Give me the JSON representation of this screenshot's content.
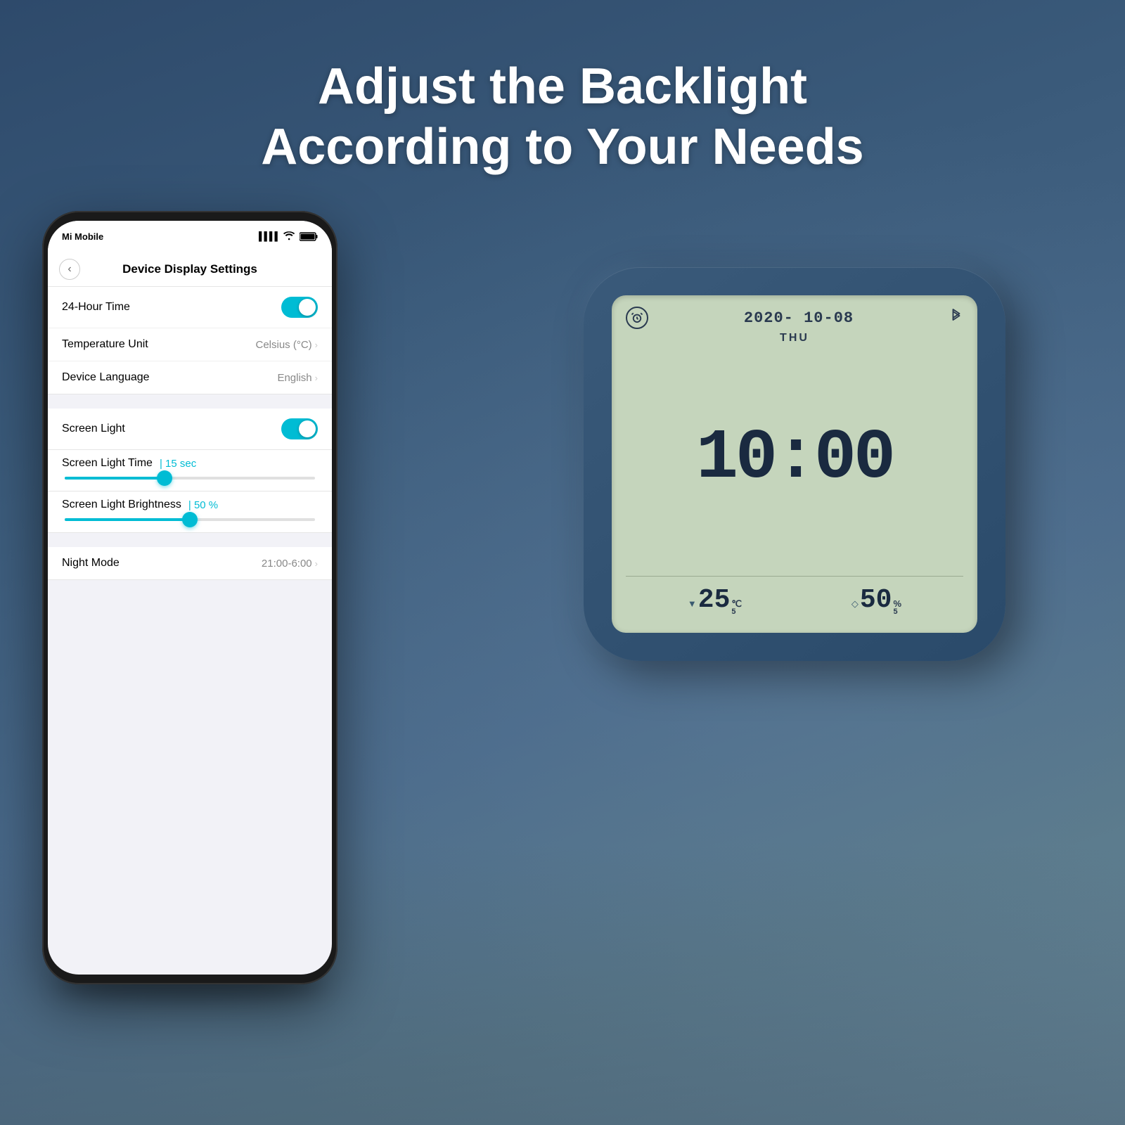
{
  "headline": {
    "line1": "Adjust the Backlight",
    "line2": "According to Your Needs"
  },
  "phone": {
    "status_bar": {
      "carrier": "Mi Mobile",
      "signal_icon": "▌▌▌▌",
      "wifi_icon": "WiFi",
      "battery_icon": "Battery"
    },
    "nav": {
      "back_label": "‹",
      "title": "Device Display Settings"
    },
    "settings": {
      "hour_time_label": "24-Hour Time",
      "hour_time_value": "on",
      "temp_unit_label": "Temperature Unit",
      "temp_unit_value": "Celsius (°C)",
      "device_language_label": "Device Language",
      "device_language_value": "English",
      "screen_light_label": "Screen Light",
      "screen_light_value": "on",
      "screen_light_time_label": "Screen Light Time",
      "screen_light_time_value": "15 sec",
      "screen_light_time_percent": 40,
      "screen_light_brightness_label": "Screen Light Brightness",
      "screen_light_brightness_value": "50 %",
      "screen_light_brightness_percent": 50,
      "night_mode_label": "Night Mode",
      "night_mode_value": "21:00-6:00"
    }
  },
  "clock": {
    "date": "2020- 10-08",
    "day": "THU",
    "time": "10:00",
    "temperature_icon": "▼",
    "temperature": "25",
    "temp_unit": "℃",
    "humidity_icon": "◇",
    "humidity": "50",
    "humidity_unit": "%",
    "bluetooth_icon": "✲"
  }
}
